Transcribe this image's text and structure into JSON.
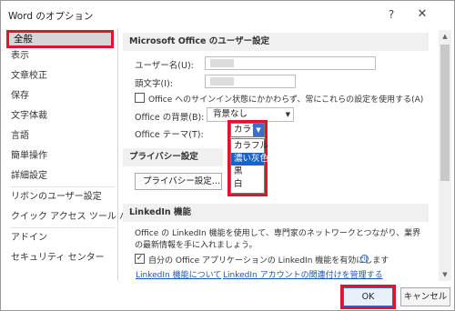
{
  "window": {
    "title": "Word のオプション",
    "help_glyph": "?",
    "close_glyph": "✕"
  },
  "sidebar": {
    "items": [
      {
        "label": "全般"
      },
      {
        "label": "表示"
      },
      {
        "label": "文章校正"
      },
      {
        "label": "保存"
      },
      {
        "label": "文字体裁"
      },
      {
        "label": "言語"
      },
      {
        "label": "簡単操作"
      },
      {
        "label": "詳細設定"
      },
      {
        "label": "リボンのユーザー設定"
      },
      {
        "label": "クイック アクセス ツール バー"
      },
      {
        "label": "アドイン"
      },
      {
        "label": "セキュリティ センター"
      }
    ]
  },
  "main": {
    "user_section": {
      "heading": "Microsoft Office のユーザー設定",
      "username_label": "ユーザー名(U):",
      "initials_label": "頭文字(I):",
      "always_use_label": "Office へのサインイン状態にかかわらず、常にこれらの設定を使用する(A)",
      "background_label": "Office の背景(B):",
      "background_value": "背景なし",
      "theme_label": "Office テーマ(T):",
      "theme_value": "カラフル",
      "theme_options": [
        "カラフル",
        "濃い灰色",
        "黒",
        "白"
      ]
    },
    "privacy_section": {
      "heading": "プライバシー設定",
      "button_label": "プライバシー設定..."
    },
    "linkedin_section": {
      "heading": "LinkedIn 機能",
      "description": "Office の LinkedIn 機能を使用して、専門家のネットワークとつながり、業界の最新情報を手に入れましょう。",
      "enable_label": "自分の Office アプリケーションの LinkedIn 機能を有効にします",
      "about_link": "LinkedIn 機能について",
      "manage_link": "LinkedIn アカウントの関連付けを管理する"
    }
  },
  "footer": {
    "ok_label": "OK",
    "cancel_label": "キャンセル"
  },
  "colors": {
    "highlight_red": "#e0142a",
    "selection_blue": "#1e62c4",
    "link_blue": "#1c55b5"
  }
}
